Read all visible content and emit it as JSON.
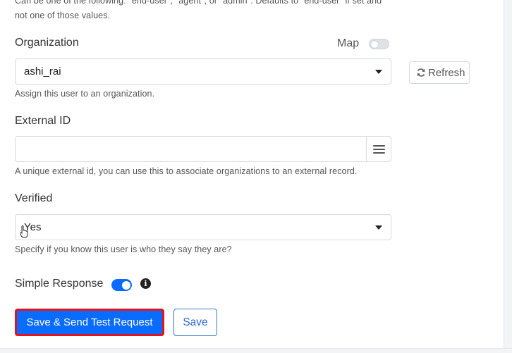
{
  "top_help_line1": "Can be one of the following: \"end-user\", \"agent\", or \"admin\". Defaults to \"end-user\" if set and",
  "top_help_line2": "not one of those values.",
  "organization": {
    "label": "Organization",
    "map_label": "Map",
    "map_enabled": false,
    "value": "ashi_rai",
    "refresh_label": "Refresh",
    "help": "Assign this user to an organization."
  },
  "external_id": {
    "label": "External ID",
    "value": "",
    "help": "A unique external id, you can use this to associate organizations to an external record."
  },
  "verified": {
    "label": "Verified",
    "value": "Yes",
    "help": "Specify if you know this user is who they say they are?"
  },
  "simple_response": {
    "label": "Simple Response",
    "enabled": true,
    "info_icon": "info-icon"
  },
  "actions": {
    "primary_label": "Save & Send Test Request",
    "secondary_label": "Save"
  },
  "colors": {
    "accent": "#0a6cff",
    "highlight_border": "#e0141e"
  }
}
